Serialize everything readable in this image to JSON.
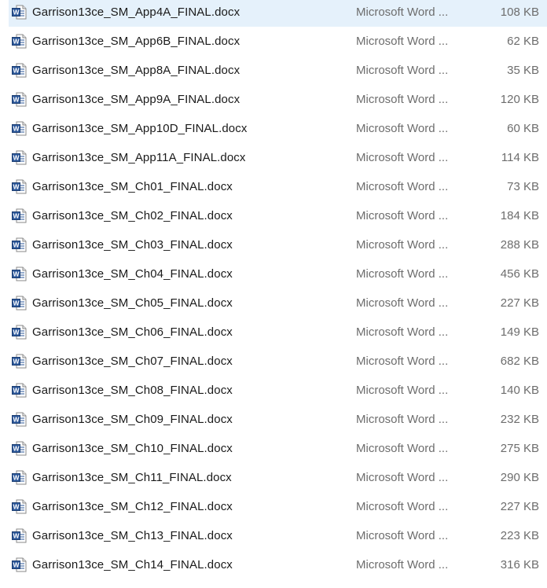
{
  "files": [
    {
      "name": "Garrison13ce_SM_App4A_FINAL.docx",
      "type": "Microsoft Word ...",
      "size": "108 KB",
      "icon": "word-document-icon",
      "selected": true
    },
    {
      "name": "Garrison13ce_SM_App6B_FINAL.docx",
      "type": "Microsoft Word ...",
      "size": "62 KB",
      "icon": "word-document-icon"
    },
    {
      "name": "Garrison13ce_SM_App8A_FINAL.docx",
      "type": "Microsoft Word ...",
      "size": "35 KB",
      "icon": "word-document-icon"
    },
    {
      "name": "Garrison13ce_SM_App9A_FINAL.docx",
      "type": "Microsoft Word ...",
      "size": "120 KB",
      "icon": "word-document-icon"
    },
    {
      "name": "Garrison13ce_SM_App10D_FINAL.docx",
      "type": "Microsoft Word ...",
      "size": "60 KB",
      "icon": "word-document-icon"
    },
    {
      "name": "Garrison13ce_SM_App11A_FINAL.docx",
      "type": "Microsoft Word ...",
      "size": "114 KB",
      "icon": "word-document-icon"
    },
    {
      "name": "Garrison13ce_SM_Ch01_FINAL.docx",
      "type": "Microsoft Word ...",
      "size": "73 KB",
      "icon": "word-document-icon"
    },
    {
      "name": "Garrison13ce_SM_Ch02_FINAL.docx",
      "type": "Microsoft Word ...",
      "size": "184 KB",
      "icon": "word-document-icon"
    },
    {
      "name": "Garrison13ce_SM_Ch03_FINAL.docx",
      "type": "Microsoft Word ...",
      "size": "288 KB",
      "icon": "word-document-icon"
    },
    {
      "name": "Garrison13ce_SM_Ch04_FINAL.docx",
      "type": "Microsoft Word ...",
      "size": "456 KB",
      "icon": "word-document-icon"
    },
    {
      "name": "Garrison13ce_SM_Ch05_FINAL.docx",
      "type": "Microsoft Word ...",
      "size": "227 KB",
      "icon": "word-document-icon"
    },
    {
      "name": "Garrison13ce_SM_Ch06_FINAL.docx",
      "type": "Microsoft Word ...",
      "size": "149 KB",
      "icon": "word-document-icon"
    },
    {
      "name": "Garrison13ce_SM_Ch07_FINAL.docx",
      "type": "Microsoft Word ...",
      "size": "682 KB",
      "icon": "word-document-icon"
    },
    {
      "name": "Garrison13ce_SM_Ch08_FINAL.docx",
      "type": "Microsoft Word ...",
      "size": "140 KB",
      "icon": "word-document-icon"
    },
    {
      "name": "Garrison13ce_SM_Ch09_FINAL.docx",
      "type": "Microsoft Word ...",
      "size": "232 KB",
      "icon": "word-document-icon"
    },
    {
      "name": "Garrison13ce_SM_Ch10_FINAL.docx",
      "type": "Microsoft Word ...",
      "size": "275 KB",
      "icon": "word-document-icon"
    },
    {
      "name": "Garrison13ce_SM_Ch11_FINAL.docx",
      "type": "Microsoft Word ...",
      "size": "290 KB",
      "icon": "word-document-icon"
    },
    {
      "name": "Garrison13ce_SM_Ch12_FINAL.docx",
      "type": "Microsoft Word ...",
      "size": "227 KB",
      "icon": "word-document-icon"
    },
    {
      "name": "Garrison13ce_SM_Ch13_FINAL.docx",
      "type": "Microsoft Word ...",
      "size": "223 KB",
      "icon": "word-document-icon"
    },
    {
      "name": "Garrison13ce_SM_Ch14_FINAL.docx",
      "type": "Microsoft Word ...",
      "size": "316 KB",
      "icon": "word-document-icon"
    }
  ],
  "colors": {
    "selected_row_bg": "#e5f1fb",
    "word_blue": "#2b579a"
  }
}
